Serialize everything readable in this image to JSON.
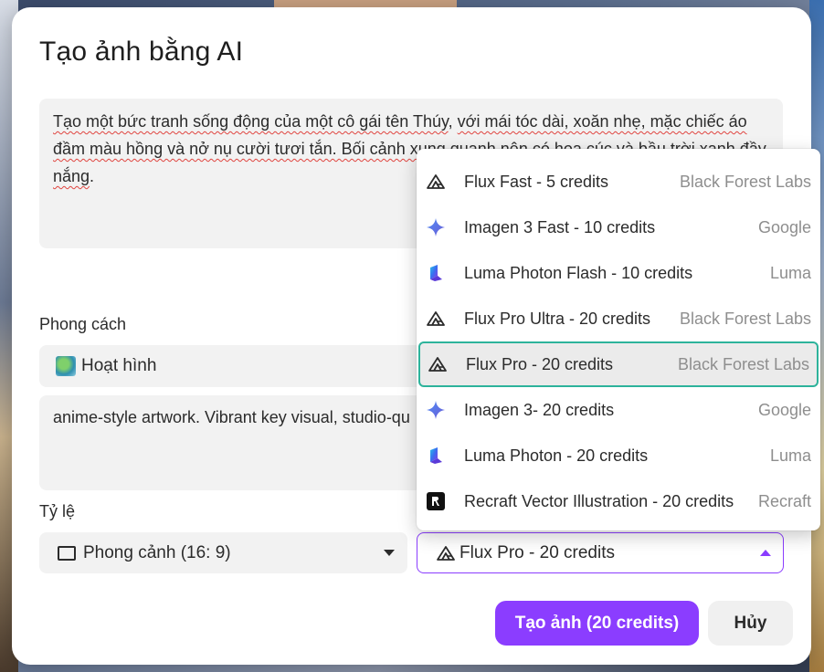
{
  "dialog": {
    "title": "Tạo ảnh bằng AI",
    "prompt": {
      "parts": [
        {
          "text": "Tạo một bức tranh sống động của một cô gái tên Thúy",
          "spell": true
        },
        {
          "text": ", ",
          "spell": false
        },
        {
          "text": "với mái tóc dài, xoăn nhẹ, mặc chiếc áo đầm màu hồng và nở nụ cười tươi tắn. Bối cảnh xung quanh nên có hoa cúc và bầu trời xanh đầy nắng",
          "spell": true
        },
        {
          "text": ".",
          "spell": false
        }
      ]
    },
    "style_label": "Phong cách",
    "style_value": "Hoạt hình",
    "style_description": "anime-style artwork. Vibrant key visual, studio-qu",
    "ratio_label": "Tỷ lệ",
    "ratio_value": "Phong cảnh (16: 9)",
    "model_value": "Flux Pro - 20 credits",
    "create_button": "Tạo ảnh (20 credits)",
    "cancel_button": "Hủy"
  },
  "model_options": [
    {
      "name": "Flux Fast - 5 credits",
      "provider": "Black Forest Labs",
      "icon": "flux-icon",
      "selected": false
    },
    {
      "name": "Imagen 3 Fast - 10 credits",
      "provider": "Google",
      "icon": "google-sparkle-icon",
      "selected": false
    },
    {
      "name": "Luma Photon Flash - 10 credits",
      "provider": "Luma",
      "icon": "luma-icon",
      "selected": false
    },
    {
      "name": "Flux Pro Ultra - 20 credits",
      "provider": "Black Forest Labs",
      "icon": "flux-icon",
      "selected": false
    },
    {
      "name": "Flux Pro - 20 credits",
      "provider": "Black Forest Labs",
      "icon": "flux-icon",
      "selected": true
    },
    {
      "name": "Imagen 3- 20 credits",
      "provider": "Google",
      "icon": "google-sparkle-icon",
      "selected": false
    },
    {
      "name": "Luma Photon - 20 credits",
      "provider": "Luma",
      "icon": "luma-icon",
      "selected": false
    },
    {
      "name": "Recraft Vector Illustration - 20 credits",
      "provider": "Recraft",
      "icon": "recraft-icon",
      "selected": false
    }
  ],
  "colors": {
    "accent": "#8b3dff",
    "selected_border": "#2db39b",
    "field_bg": "#f2f2f2"
  }
}
